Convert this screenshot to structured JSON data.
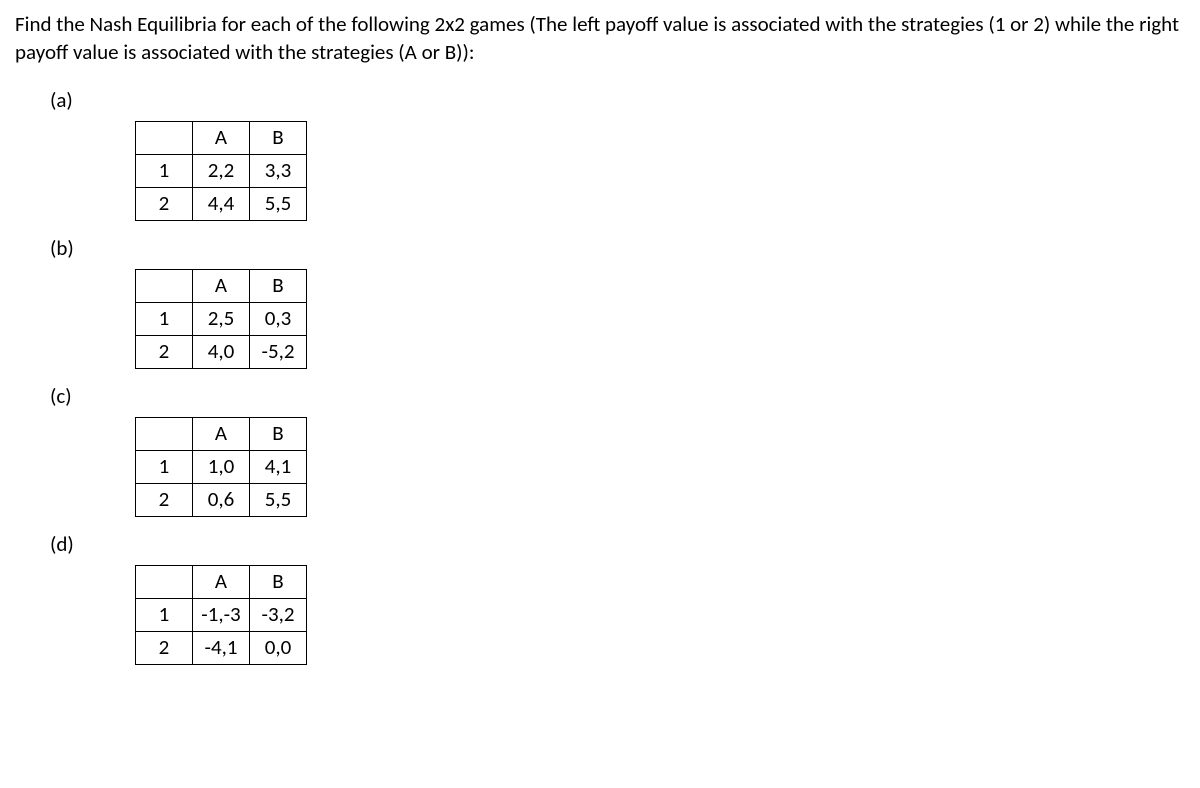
{
  "prompt": "Find the Nash Equilibria for each of the following 2x2 games (The left payoff value is associated with the strategies (1 or 2) while the right payoff value is associated with the strategies (A or B)):",
  "games": [
    {
      "label": "(a)",
      "colA": "A",
      "colB": "B",
      "row1": "1",
      "row2": "2",
      "c1A": "2,2",
      "c1B": "3,3",
      "c2A": "4,4",
      "c2B": "5,5"
    },
    {
      "label": "(b)",
      "colA": "A",
      "colB": "B",
      "row1": "1",
      "row2": "2",
      "c1A": "2,5",
      "c1B": "0,3",
      "c2A": "4,0",
      "c2B": "-5,2"
    },
    {
      "label": "(c)",
      "colA": "A",
      "colB": "B",
      "row1": "1",
      "row2": "2",
      "c1A": "1,0",
      "c1B": "4,1",
      "c2A": "0,6",
      "c2B": "5,5"
    },
    {
      "label": "(d)",
      "colA": "A",
      "colB": "B",
      "row1": "1",
      "row2": "2",
      "c1A": "-1,-3",
      "c1B": "-3,2",
      "c2A": "-4,1",
      "c2B": "0,0"
    }
  ]
}
